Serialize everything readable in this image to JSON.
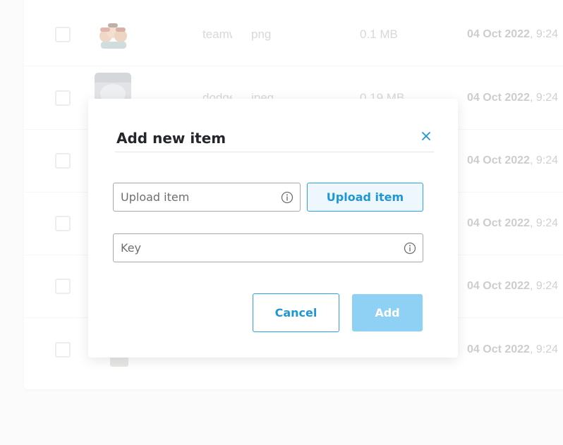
{
  "table": {
    "rows": [
      {
        "name": "teamwork",
        "type": "png",
        "size": "0.1 MB",
        "date_bold": "04 Oct 2022",
        "time": ", 9:24"
      },
      {
        "name": "dodge",
        "type": "jpeg",
        "size": "0.19 MB",
        "date_bold": "04 Oct 2022",
        "time": ", 9:24"
      },
      {
        "name": "",
        "type": "",
        "size": "",
        "date_bold": "04 Oct 2022",
        "time": ", 9:24"
      },
      {
        "name": "",
        "type": "",
        "size": "",
        "date_bold": "04 Oct 2022",
        "time": ", 9:24"
      },
      {
        "name": "",
        "type": "",
        "size": "",
        "date_bold": "04 Oct 2022",
        "time": ", 9:24"
      },
      {
        "name": "",
        "type": "",
        "size": "",
        "date_bold": "04 Oct 2022",
        "time": ", 9:24"
      }
    ]
  },
  "modal": {
    "title": "Add new item",
    "close_icon": "close-icon",
    "upload_field": {
      "placeholder": "Upload item",
      "value": "",
      "icon": "info-icon"
    },
    "upload_button_label": "Upload item",
    "key_field": {
      "placeholder": "Key",
      "value": "",
      "icon": "info-icon"
    },
    "cancel_label": "Cancel",
    "add_label": "Add"
  },
  "colors": {
    "accent": "#1f97d6",
    "accent_border": "#2aa3df",
    "add_disabled": "#8fd0f5",
    "title": "#24262c"
  }
}
